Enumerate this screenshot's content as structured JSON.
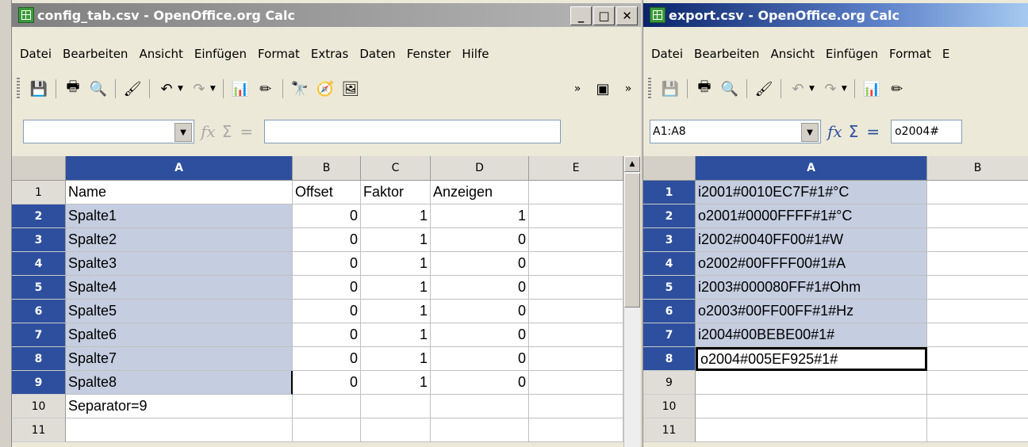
{
  "win1": {
    "title": "config_tab.csv - OpenOffice.org Calc",
    "menu": [
      "Datei",
      "Bearbeiten",
      "Ansicht",
      "Einfügen",
      "Format",
      "Extras",
      "Daten",
      "Fenster",
      "Hilfe"
    ],
    "namebox": "",
    "formula": "",
    "columns": [
      "A",
      "B",
      "C",
      "D",
      "E"
    ],
    "rows": [
      {
        "n": "1",
        "a": "Name",
        "b": "Offset",
        "c": "Faktor",
        "d": "Anzeigen"
      },
      {
        "n": "2",
        "a": "Spalte1",
        "b": "0",
        "c": "1",
        "d": "1"
      },
      {
        "n": "3",
        "a": "Spalte2",
        "b": "0",
        "c": "1",
        "d": "0"
      },
      {
        "n": "4",
        "a": "Spalte3",
        "b": "0",
        "c": "1",
        "d": "0"
      },
      {
        "n": "5",
        "a": "Spalte4",
        "b": "0",
        "c": "1",
        "d": "0"
      },
      {
        "n": "6",
        "a": "Spalte5",
        "b": "0",
        "c": "1",
        "d": "0"
      },
      {
        "n": "7",
        "a": "Spalte6",
        "b": "0",
        "c": "1",
        "d": "0"
      },
      {
        "n": "8",
        "a": "Spalte7",
        "b": "0",
        "c": "1",
        "d": "0"
      },
      {
        "n": "9",
        "a": "Spalte8",
        "b": "0",
        "c": "1",
        "d": "0"
      },
      {
        "n": "10",
        "a": "Separator=9",
        "b": "",
        "c": "",
        "d": ""
      },
      {
        "n": "11",
        "a": "",
        "b": "",
        "c": "",
        "d": ""
      }
    ]
  },
  "win2": {
    "title": "export.csv - OpenOffice.org Calc",
    "menu": [
      "Datei",
      "Bearbeiten",
      "Ansicht",
      "Einfügen",
      "Format",
      "E"
    ],
    "namebox": "A1:A8",
    "formula": "o2004#",
    "columns": [
      "A",
      "B"
    ],
    "rows": [
      {
        "n": "1",
        "a": "i2001#0010EC7F#1#°C"
      },
      {
        "n": "2",
        "a": "o2001#0000FFFF#1#°C"
      },
      {
        "n": "3",
        "a": "i2002#0040FF00#1#W"
      },
      {
        "n": "4",
        "a": "o2002#00FFFF00#1#A"
      },
      {
        "n": "5",
        "a": "i2003#000080FF#1#Ohm"
      },
      {
        "n": "6",
        "a": "o2003#00FF00FF#1#Hz"
      },
      {
        "n": "7",
        "a": "i2004#00BEBE00#1#"
      },
      {
        "n": "8",
        "a": "o2004#005EF925#1#"
      },
      {
        "n": "9",
        "a": ""
      },
      {
        "n": "10",
        "a": ""
      },
      {
        "n": "11",
        "a": ""
      }
    ]
  }
}
